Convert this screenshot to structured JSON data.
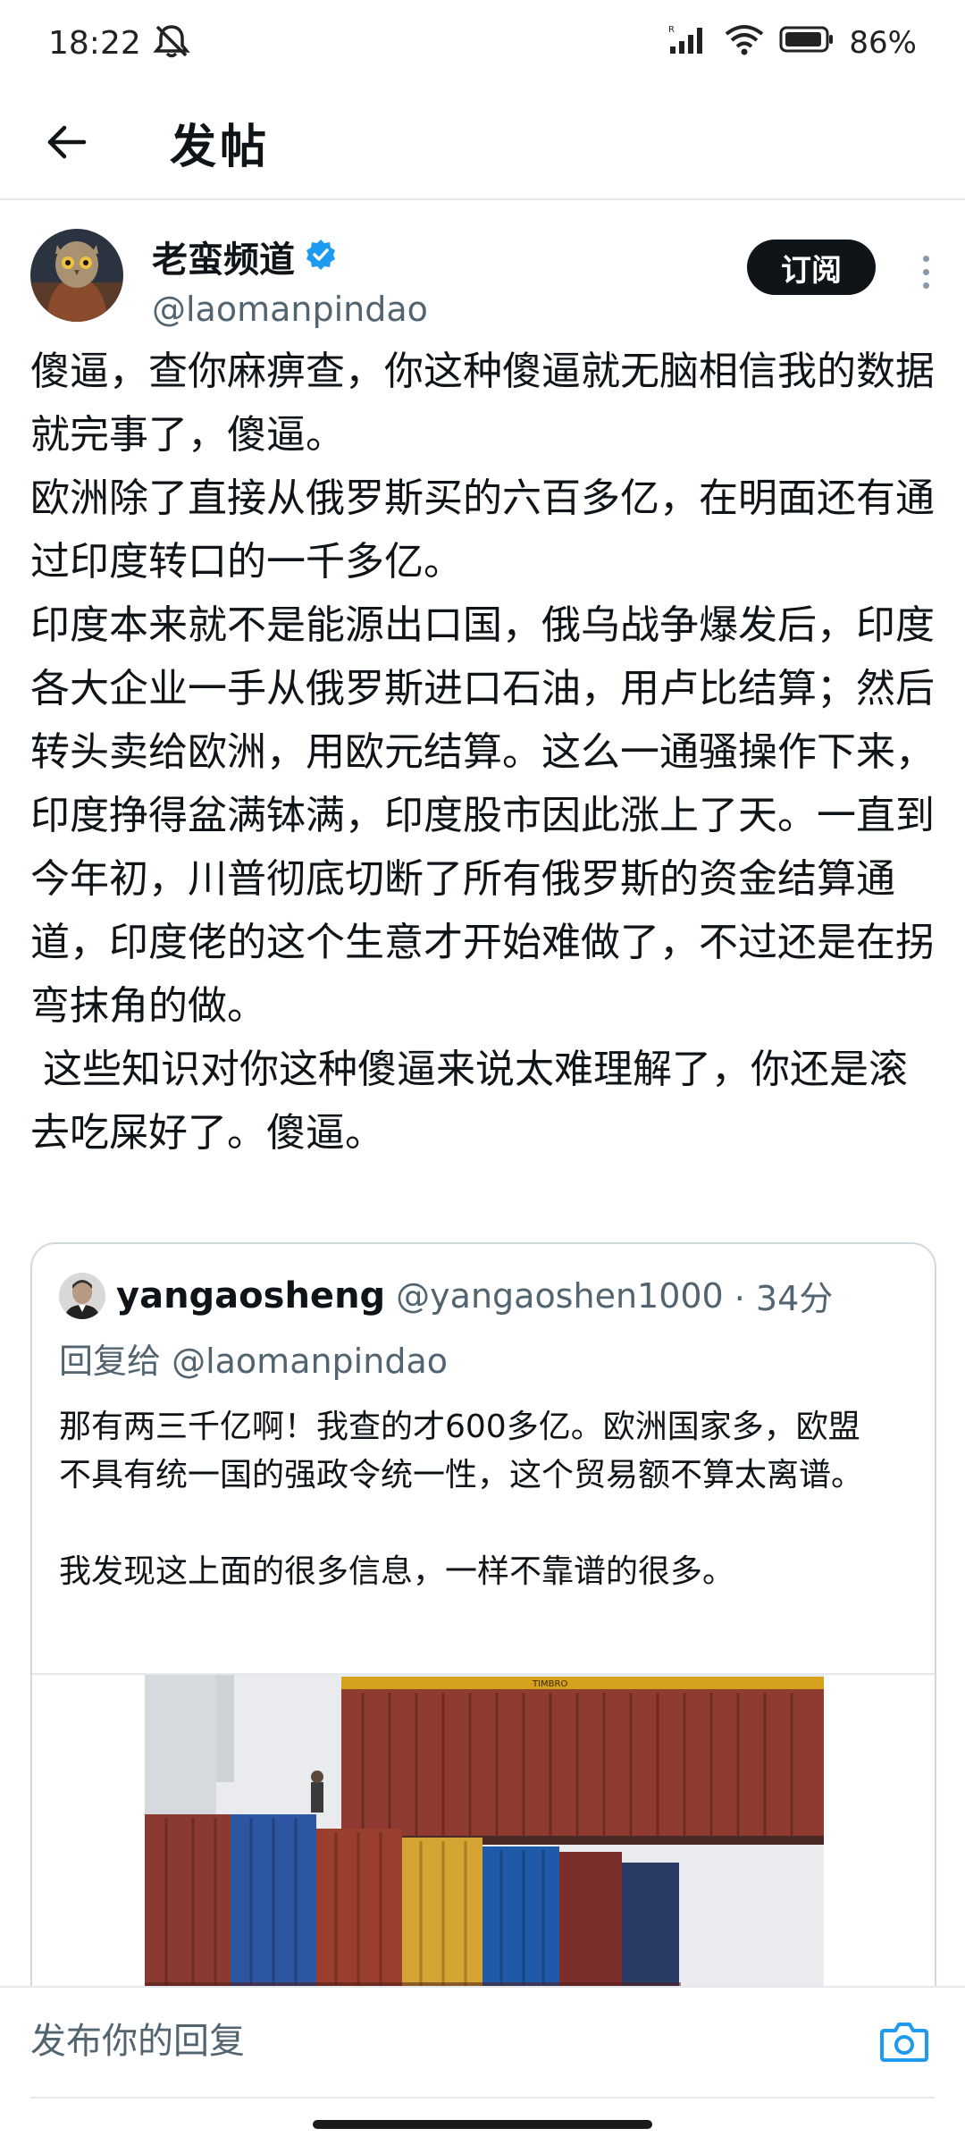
{
  "status_bar": {
    "time": "18:22",
    "battery": "86%",
    "icons": [
      "mute-icon",
      "signal-icon",
      "wifi-icon",
      "battery-icon"
    ]
  },
  "header": {
    "title": "发帖",
    "back_icon": "arrow-left-icon"
  },
  "post": {
    "author_name": "老蛮频道",
    "verified": true,
    "author_handle": "@laomanpindao",
    "subscribe_label": "订阅",
    "body": "傻逼，查你麻痹查，你这种傻逼就无脑相信我的数据就完事了，傻逼。\n欧洲除了直接从俄罗斯买的六百多亿，在明面还有通过印度转口的一千多亿。\n印度本来就不是能源出口国，俄乌战争爆发后，印度各大企业一手从俄罗斯进口石油，用卢比结算；然后转头卖给欧洲，用欧元结算。这么一通骚操作下来， 印度挣得盆满钵满，印度股市因此涨上了天。一直到今年初，川普彻底切断了所有俄罗斯的资金结算通道，印度佬的这个生意才开始难做了，不过还是在拐弯抹角的做。\n 这些知识对你这种傻逼来说太难理解了，你还是滚去吃屎好了。傻逼。"
  },
  "quote": {
    "author_name": "yangaosheng",
    "author_handle": "@yangaoshen1000",
    "time": "· 34分",
    "reply_to": "回复给 @laomanpindao",
    "text": "那有两三千亿啊！我查的才600多亿。欧洲国家多，欧盟不具有统一国的强政令统一性，这个贸易额不算太离谱。\n\n我发现这上面的很多信息，一样不靠谱的很多。",
    "image_container_label": "TIMBRO"
  },
  "reply_bar": {
    "placeholder": "发布你的回复",
    "camera_icon": "camera-icon"
  },
  "colors": {
    "text_primary": "#0f1419",
    "text_secondary": "#536471",
    "accent": "#1d9bf0",
    "border": "#cfd9de"
  }
}
